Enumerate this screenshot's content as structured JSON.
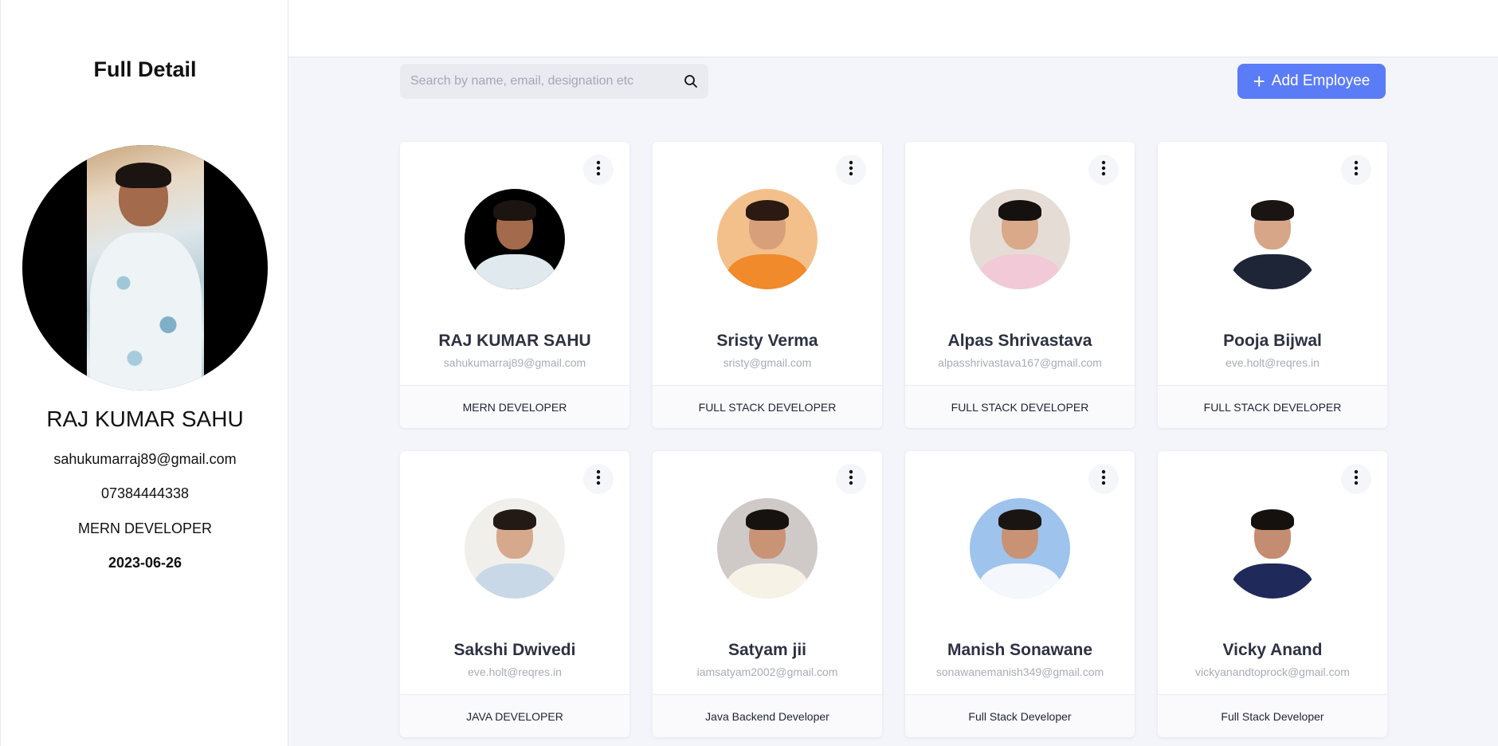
{
  "sidebar": {
    "title": "Full Detail",
    "name": "RAJ KUMAR SAHU",
    "email": "sahukumarraj89@gmail.com",
    "phone": "07384444338",
    "role": "MERN DEVELOPER",
    "date": "2023-06-26"
  },
  "search": {
    "placeholder": "Search by name, email, designation etc",
    "value": ""
  },
  "add_button": {
    "label": "Add Employee"
  },
  "colors": {
    "accent": "#5b7cf7",
    "background": "#f4f5fa"
  },
  "icons": {
    "search": "search-icon",
    "add": "plus-icon",
    "menu": "more-vertical-icon"
  },
  "employees": [
    {
      "name": "RAJ KUMAR SAHU",
      "email": "sahukumarraj89@gmail.com",
      "designation": "MERN DEVELOPER",
      "avatar_bg": "#000000",
      "skin": "#a36a4b",
      "hair": "#1c1410",
      "shirt": "#dfe9ee"
    },
    {
      "name": "Sristy Verma",
      "email": "sristy@gmail.com",
      "designation": "FULL STACK DEVELOPER",
      "avatar_bg": "#f3c08c",
      "skin": "#d8a07a",
      "hair": "#2b1a12",
      "shirt": "#f08a2a"
    },
    {
      "name": "Alpas Shrivastava",
      "email": "alpasshrivastava167@gmail.com",
      "designation": "FULL STACK DEVELOPER",
      "avatar_bg": "#e6dcd6",
      "skin": "#d9a98a",
      "hair": "#15110f",
      "shirt": "#f2c9d6"
    },
    {
      "name": "Pooja Bijwal",
      "email": "eve.holt@reqres.in",
      "designation": "FULL STACK DEVELOPER",
      "avatar_bg": "#ffffff",
      "skin": "#d7a588",
      "hair": "#1a1412",
      "shirt": "#1d2536"
    },
    {
      "name": "Sakshi Dwivedi",
      "email": "eve.holt@reqres.in",
      "designation": "JAVA DEVELOPER",
      "avatar_bg": "#f1efec",
      "skin": "#d6a98d",
      "hair": "#231a16",
      "shirt": "#c9d8e6"
    },
    {
      "name": "Satyam jii",
      "email": "iamsatyam2002@gmail.com",
      "designation": "Java Backend Developer",
      "avatar_bg": "#cfcac8",
      "skin": "#c99376",
      "hair": "#161210",
      "shirt": "#f7f2e6"
    },
    {
      "name": "Manish Sonawane",
      "email": "sonawanemanish349@gmail.com",
      "designation": "Full Stack Developer",
      "avatar_bg": "#9ec3ec",
      "skin": "#c99275",
      "hair": "#1a1512",
      "shirt": "#f4f7fb"
    },
    {
      "name": "Vicky Anand",
      "email": "vickyanandtoprock@gmail.com",
      "designation": "Full Stack Developer",
      "avatar_bg": "#ffffff",
      "skin": "#c48c70",
      "hair": "#15110f",
      "shirt": "#1f2a5a"
    }
  ]
}
